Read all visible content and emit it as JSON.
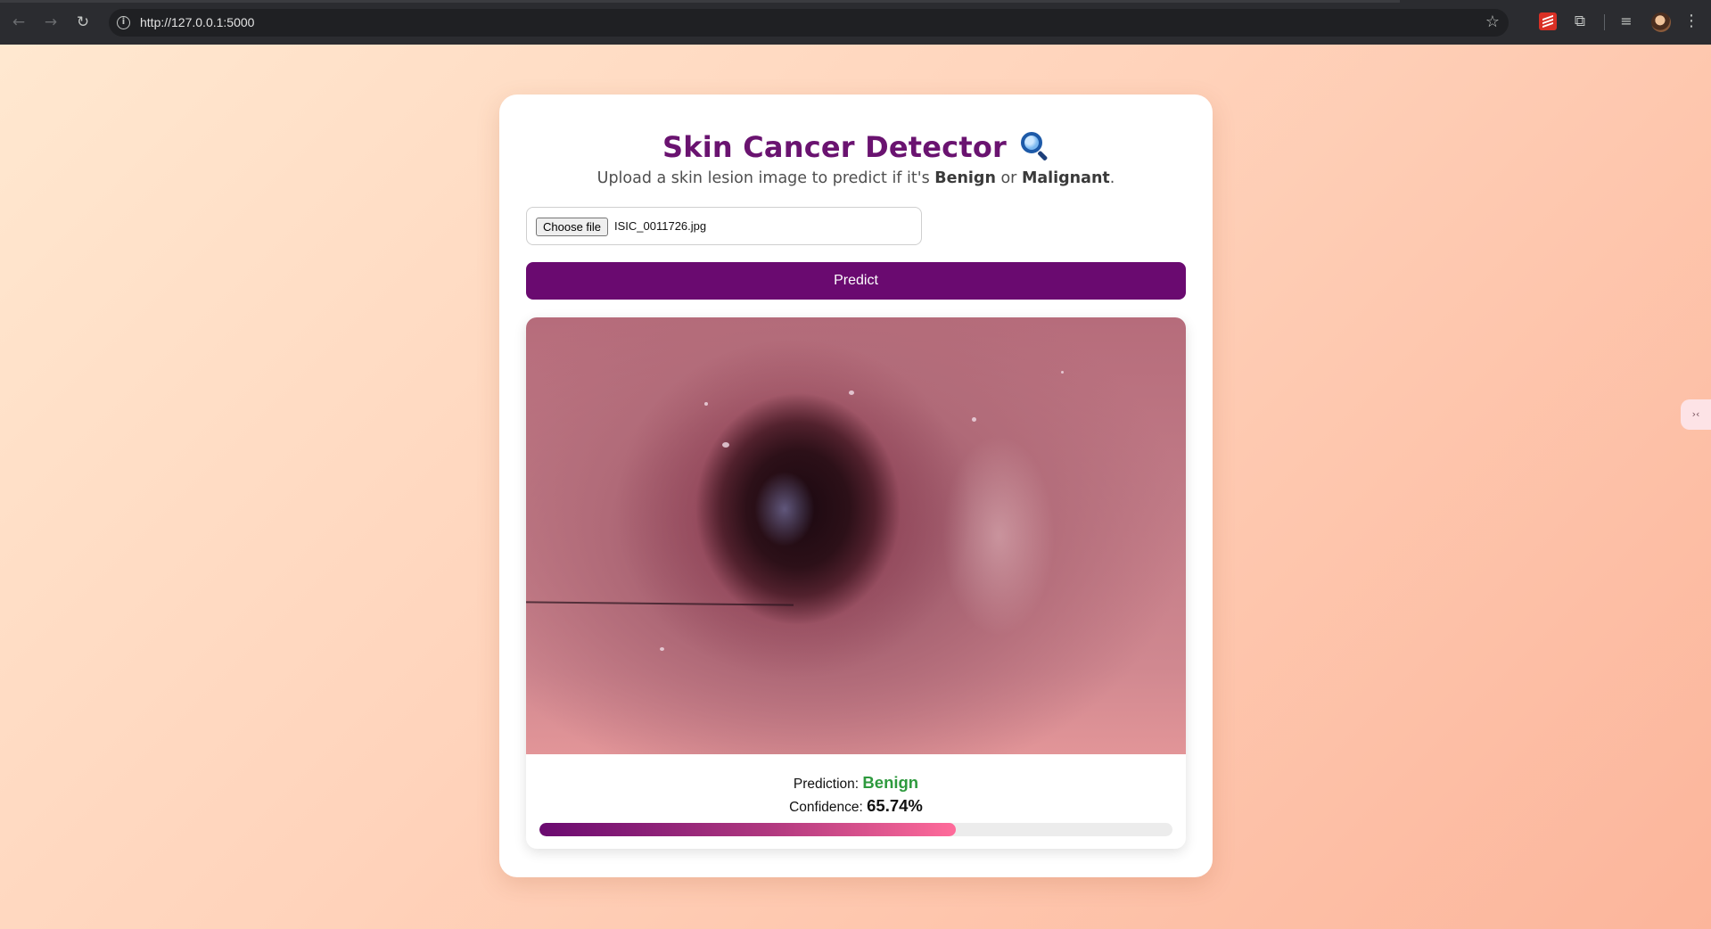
{
  "browser": {
    "url": "http://127.0.0.1:5000",
    "icons": {
      "back": "arrow-left-icon",
      "forward": "arrow-right-icon",
      "reload": "reload-icon",
      "info": "info-icon",
      "bookmark": "star-icon",
      "extension": "puzzle-icon",
      "media": "media-control-icon",
      "menu": "kebab-menu-icon"
    }
  },
  "app": {
    "title": "Skin Cancer Detector",
    "title_icon": "magnifier-icon",
    "subtitle_prefix": "Upload a skin lesion image to predict if it's ",
    "subtitle_benign": "Benign",
    "subtitle_or": " or ",
    "subtitle_malignant": "Malignant",
    "subtitle_suffix": "."
  },
  "upload": {
    "choose_label": "Choose file",
    "file_name": "ISIC_0011726.jpg"
  },
  "predict_button": "Predict",
  "result": {
    "prediction_label": "Prediction:",
    "prediction_value": "Benign",
    "confidence_label": "Confidence:",
    "confidence_value": "65.74%",
    "confidence_fraction": 0.6574
  },
  "colors": {
    "accent": "#6a0a70",
    "benign": "#2e9a3e",
    "bar_end": "#ff6b9a"
  }
}
